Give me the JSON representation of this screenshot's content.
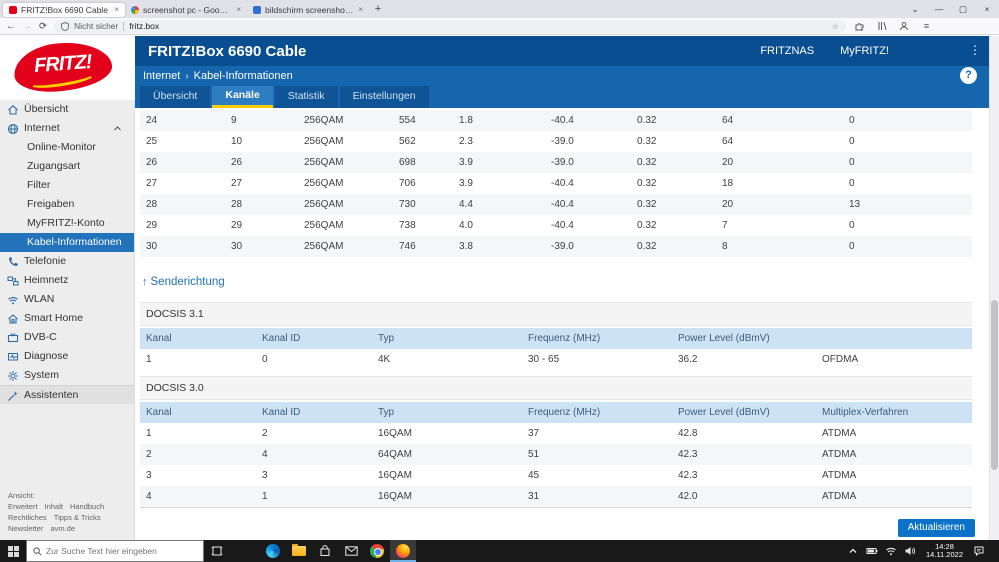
{
  "browser": {
    "tabs": [
      {
        "title": "FRITZ!Box 6690 Cable",
        "active": true
      },
      {
        "title": "screenshot pc - Google Suche",
        "active": false
      },
      {
        "title": "bildschirm screenshot erstellen",
        "active": false
      }
    ],
    "tab_close_glyph": "×",
    "new_tab_glyph": "+",
    "tab_list_glyph": "⌄",
    "window_controls": {
      "minimize": "—",
      "maximize": "▢",
      "close": "×"
    },
    "nav": {
      "back": "←",
      "forward": "→",
      "reload": "⟳",
      "menu": "≡"
    },
    "address": {
      "security_label": "Nicht sicher",
      "url": "fritz.box",
      "star": "☆"
    }
  },
  "app": {
    "logo_text": "FRITZ!",
    "title": "FRITZ!Box 6690 Cable",
    "nav_links": [
      "FRITZNAS",
      "MyFRITZ!"
    ],
    "overflow_glyph": "⋮",
    "breadcrumb": {
      "section": "Internet",
      "separator": "›",
      "page": "Kabel-Informationen"
    },
    "help_label": "?",
    "tabs": [
      {
        "label": "Übersicht",
        "active": false
      },
      {
        "label": "Kanäle",
        "active": true
      },
      {
        "label": "Statistik",
        "active": false
      },
      {
        "label": "Einstellungen",
        "active": false
      }
    ]
  },
  "sidebar": {
    "items": [
      {
        "label": "Übersicht"
      },
      {
        "label": "Internet"
      },
      {
        "label": "Online-Monitor"
      },
      {
        "label": "Zugangsart"
      },
      {
        "label": "Filter"
      },
      {
        "label": "Freigaben"
      },
      {
        "label": "MyFRITZ!-Konto"
      },
      {
        "label": "Kabel-Informationen"
      },
      {
        "label": "Telefonie"
      },
      {
        "label": "Heimnetz"
      },
      {
        "label": "WLAN"
      },
      {
        "label": "Smart Home"
      },
      {
        "label": "DVB-C"
      },
      {
        "label": "Diagnose"
      },
      {
        "label": "System"
      },
      {
        "label": "Assistenten"
      }
    ],
    "footer_links": [
      [
        "Ansicht: Erweitert",
        "Inhalt",
        "Handbuch"
      ],
      [
        "Rechtliches",
        "Tipps & Tricks"
      ],
      [
        "Newsletter",
        "avm.de"
      ]
    ]
  },
  "content": {
    "downstream_rows": [
      [
        "24",
        "9",
        "256QAM",
        "554",
        "1.8",
        "-40.4",
        "0.32",
        "64",
        "0"
      ],
      [
        "25",
        "10",
        "256QAM",
        "562",
        "2.3",
        "-39.0",
        "0.32",
        "64",
        "0"
      ],
      [
        "26",
        "26",
        "256QAM",
        "698",
        "3.9",
        "-39.0",
        "0.32",
        "20",
        "0"
      ],
      [
        "27",
        "27",
        "256QAM",
        "706",
        "3.9",
        "-40.4",
        "0.32",
        "18",
        "0"
      ],
      [
        "28",
        "28",
        "256QAM",
        "730",
        "4.4",
        "-40.4",
        "0.32",
        "20",
        "13"
      ],
      [
        "29",
        "29",
        "256QAM",
        "738",
        "4.0",
        "-40.4",
        "0.32",
        "7",
        "0"
      ],
      [
        "30",
        "30",
        "256QAM",
        "746",
        "3.8",
        "-39.0",
        "0.32",
        "8",
        "0"
      ]
    ],
    "upstream": {
      "arrow": "↑",
      "heading": "Senderichtung",
      "docsis31": {
        "label": "DOCSIS 3.1",
        "headers": [
          "Kanal",
          "Kanal ID",
          "Typ",
          "Frequenz (MHz)",
          "Power Level (dBmV)",
          ""
        ],
        "rows": [
          [
            "1",
            "0",
            "4K",
            "30 - 65",
            "36.2",
            "OFDMA"
          ]
        ]
      },
      "docsis30": {
        "label": "DOCSIS 3.0",
        "headers": [
          "Kanal",
          "Kanal ID",
          "Typ",
          "Frequenz (MHz)",
          "Power Level (dBmV)",
          "Multiplex-Verfahren"
        ],
        "rows": [
          [
            "1",
            "2",
            "16QAM",
            "37",
            "42.8",
            "ATDMA"
          ],
          [
            "2",
            "4",
            "64QAM",
            "51",
            "42.3",
            "ATDMA"
          ],
          [
            "3",
            "3",
            "16QAM",
            "45",
            "42.3",
            "ATDMA"
          ],
          [
            "4",
            "1",
            "16QAM",
            "31",
            "42.0",
            "ATDMA"
          ]
        ]
      }
    },
    "refresh_button": "Aktualisieren"
  },
  "taskbar": {
    "search_placeholder": "Zur Suche Text hier eingeben",
    "clock": {
      "time": "14:28",
      "date": "14.11.2022"
    }
  }
}
